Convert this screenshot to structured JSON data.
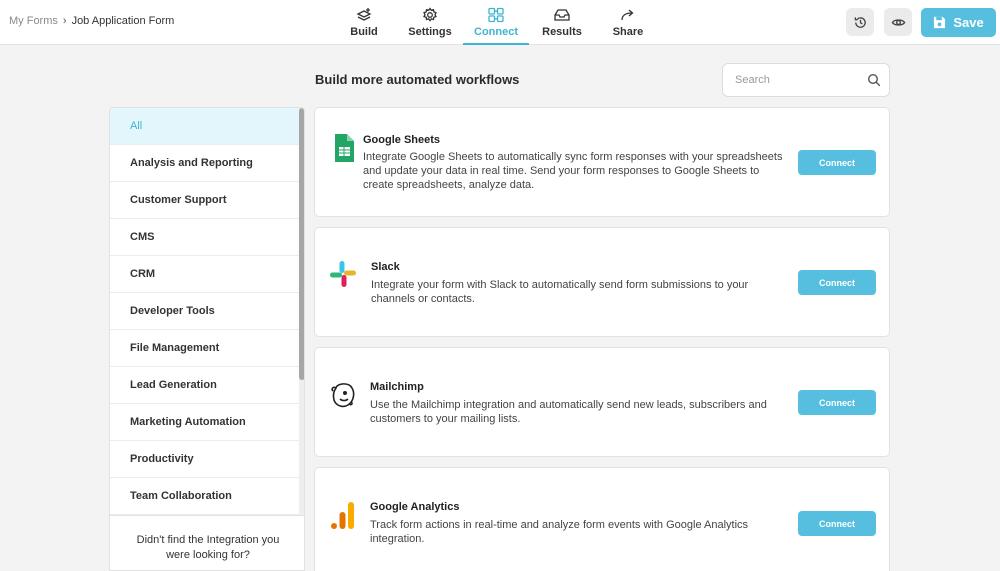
{
  "breadcrumb": {
    "root": "My Forms",
    "separator": "›",
    "current": "Job Application Form"
  },
  "nav": {
    "tabs": [
      {
        "label": "Build",
        "icon": "build-icon"
      },
      {
        "label": "Settings",
        "icon": "gear-icon"
      },
      {
        "label": "Connect",
        "icon": "puzzle-icon",
        "active": true
      },
      {
        "label": "Results",
        "icon": "inbox-icon"
      },
      {
        "label": "Share",
        "icon": "share-icon"
      }
    ]
  },
  "toolbar": {
    "history_icon": "history-icon",
    "preview_icon": "eye-icon",
    "save_label": "Save"
  },
  "main": {
    "heading": "Build more automated workflows",
    "search": {
      "placeholder": "Search",
      "value": ""
    }
  },
  "sidebar": {
    "items": [
      {
        "label": "All",
        "active": true
      },
      {
        "label": "Analysis and Reporting"
      },
      {
        "label": "Customer Support"
      },
      {
        "label": "CMS"
      },
      {
        "label": "CRM"
      },
      {
        "label": "Developer Tools"
      },
      {
        "label": "File Management"
      },
      {
        "label": "Lead Generation"
      },
      {
        "label": "Marketing Automation"
      },
      {
        "label": "Productivity"
      },
      {
        "label": "Team Collaboration"
      }
    ],
    "help_text": "Didn't find the Integration you were looking for?"
  },
  "integrations": [
    {
      "name": "Google Sheets",
      "description": "Integrate Google Sheets to automatically sync form responses with your spreadsheets and update your data in real time. Send your form responses to Google Sheets to create spreadsheets, analyze data.",
      "button": "Connect",
      "icon": "google-sheets-icon"
    },
    {
      "name": "Slack",
      "description": "Integrate your form with Slack to automatically send form submissions to your channels or contacts.",
      "button": "Connect",
      "icon": "slack-icon"
    },
    {
      "name": "Mailchimp",
      "description": "Use the Mailchimp integration and automatically send new leads, subscribers and customers to your mailing lists.",
      "button": "Connect",
      "icon": "mailchimp-icon"
    },
    {
      "name": "Google Analytics",
      "description": "Track form actions in real-time and analyze form events with Google Analytics integration.",
      "button": "Connect",
      "icon": "google-analytics-icon"
    }
  ],
  "colors": {
    "accent": "#56bfe0",
    "accent_text": "#3eb3d4",
    "active_bg": "#e3f6fc"
  }
}
